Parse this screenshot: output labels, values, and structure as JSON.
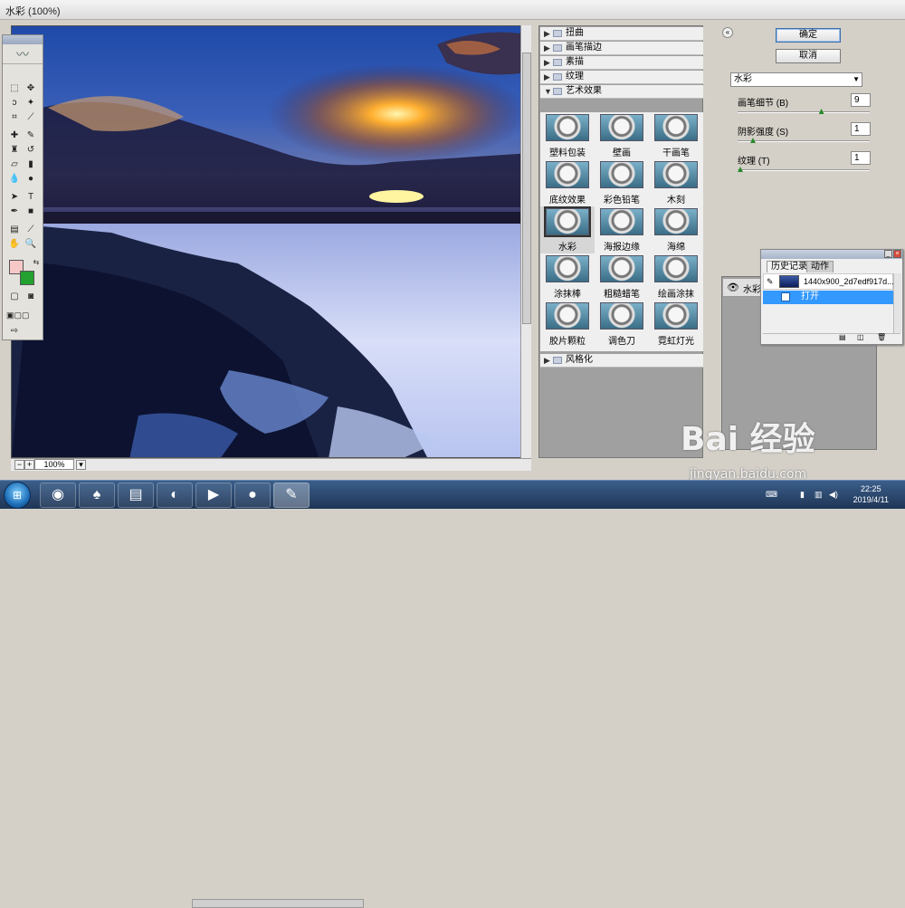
{
  "window": {
    "title": "水彩 (100%)"
  },
  "preview": {
    "zoom": "100%"
  },
  "filter_gallery": {
    "categories_top": [
      {
        "label": "扭曲"
      },
      {
        "label": "画笔描边"
      },
      {
        "label": "素描"
      },
      {
        "label": "纹理"
      }
    ],
    "open_category": "艺术效果",
    "thumbnails": [
      {
        "label": "塑料包装"
      },
      {
        "label": "壁画"
      },
      {
        "label": "干画笔"
      },
      {
        "label": "底纹效果"
      },
      {
        "label": "彩色铅笔"
      },
      {
        "label": "木刻"
      },
      {
        "label": "水彩"
      },
      {
        "label": "海报边缘"
      },
      {
        "label": "海绵"
      },
      {
        "label": "涂抹棒"
      },
      {
        "label": "粗糙蜡笔"
      },
      {
        "label": "绘画涂抹"
      },
      {
        "label": "胶片颗粒"
      },
      {
        "label": "调色刀"
      },
      {
        "label": "霓虹灯光"
      }
    ],
    "selected_thumbnail": "水彩",
    "category_bottom": "风格化"
  },
  "buttons": {
    "ok": "确定",
    "cancel": "取消",
    "collapse": "«"
  },
  "settings": {
    "filter_select": "水彩",
    "params": [
      {
        "label": "画笔细节 (B)",
        "value": "9",
        "level": 0.64
      },
      {
        "label": "阴影强度 (S)",
        "value": "1",
        "level": 0.1
      },
      {
        "label": "纹理 (T)",
        "value": "1",
        "level": 0.0
      }
    ]
  },
  "layers": {
    "row_label": "水彩"
  },
  "history": {
    "tabs": [
      "历史记录",
      "动作"
    ],
    "snapshot": "1440x900_2d7edf917d...",
    "step": "打开"
  },
  "taskbar": {
    "apps": [
      {
        "name": "360-icon",
        "glyph": "◉"
      },
      {
        "name": "qq-icon",
        "glyph": "♠"
      },
      {
        "name": "explorer-icon",
        "glyph": "▤"
      },
      {
        "name": "firefox-icon",
        "glyph": "◐"
      },
      {
        "name": "video-icon",
        "glyph": "▶"
      },
      {
        "name": "recorder-icon",
        "glyph": "●"
      },
      {
        "name": "photoshop-feather-icon",
        "glyph": "✎"
      }
    ],
    "time": "22:25",
    "date": "2019/4/11"
  },
  "watermark": {
    "logo": "Bai 经验",
    "url": "jingyan.baidu.com"
  }
}
